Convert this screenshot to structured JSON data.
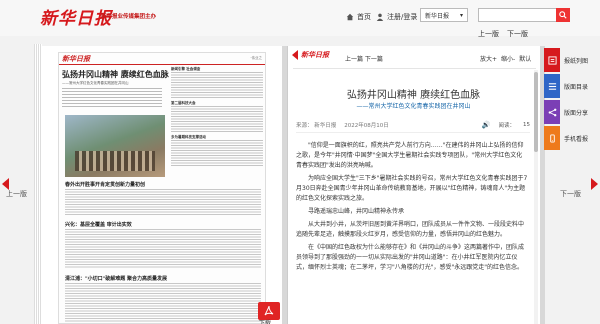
{
  "header": {
    "logo": "新华日报",
    "logo_sub": "新华报业传媒集团主办",
    "home": "首页",
    "login": "注册/登录",
    "paper_select": "新华日报",
    "search_button_icon": "search-icon",
    "prev_page": "上一版",
    "next_page": "下一版"
  },
  "left_page": {
    "masthead": "新华日报",
    "edition_label": "·伟业之",
    "headline": "弘扬井冈山精神  赓续红色血脉",
    "subhead": "——常州大学红色文化青春实践团在井冈山",
    "side_headlines": [
      "新闻引擎 社会调查",
      "第二届科技大会",
      "多为暑期科技支撑活动"
    ],
    "story2": "春外出开胜事开肯定贯创新力量初创",
    "story3": "兴化：基层全覆盖  审计出实效",
    "story4": "清江浦：\"小切口\"破解难题  聚合力高质量发展",
    "pdf_icon": "pdf-icon",
    "pdf_label": "下载"
  },
  "nav": {
    "left_label": "上一版",
    "right_label": "下一版"
  },
  "article": {
    "logo": "新华日报",
    "nav": "上一篇  下一篇",
    "zoom_in": "放大+",
    "zoom_out": "缩小-",
    "default": "默认",
    "title": "弘扬井冈山精神  赓续红色血脉",
    "subtitle": "——常州大学红色文化青春实践团在井冈山",
    "source": "来源：  新华日报",
    "date": "2022年08月10日",
    "read_label": "阅读：",
    "read_count": "15",
    "paragraphs": [
      "\"信仰是一面旗帜的红，照亮共产党人前行方向……\"在建伟的井冈山上弘扬的信仰之歌，是今年\"井冈情·中国梦\"全国大学生暑期社会实践专项团队，\"常州大学红色文化青春实践团\"发出的洪亮呐喊。",
      "为响应全国大学生\"三下乡\"暑期社会实践的号召，常州大学红色文化青春实践团于7月30日奔赴全国青少年井冈山革命传统教育基地，开展以\"红色精神，铸魂育人\"为主题的红色文化探索实践之旅。",
      "寻路遥瑞忠山峰，井冈山精神永传承",
      "从大井到小井，从茨坪旧居到黄洋界哨口，团队成员从一件件文物、一段段史料中追随先辈足迹，触摸那段火红岁月，感受信仰的力量，感悟井冈山的红色魅力。",
      "在《中国的红色政权为什么能够存在》和《井冈山的斗争》这两篇著作中，团队成员领导到了那股强劲的一一切从实际出发的\"井冈山道路\"：在小井红军医院内忆立仪式，缅怀烈士英魂；在二茅坪，学习\"八角楼的灯光\"，感受\"永远跟党走\"的红色信念。"
    ]
  },
  "side_toolbar": [
    {
      "label": "报纸列图",
      "color": "#d6191d",
      "icon": "newspaper-icon"
    },
    {
      "label": "版面目录",
      "color": "#2f66c7",
      "icon": "list-icon"
    },
    {
      "label": "版面分享",
      "color": "#7b3fb5",
      "icon": "share-icon"
    },
    {
      "label": "手机看报",
      "color": "#ee7a1b",
      "icon": "phone-icon"
    }
  ]
}
